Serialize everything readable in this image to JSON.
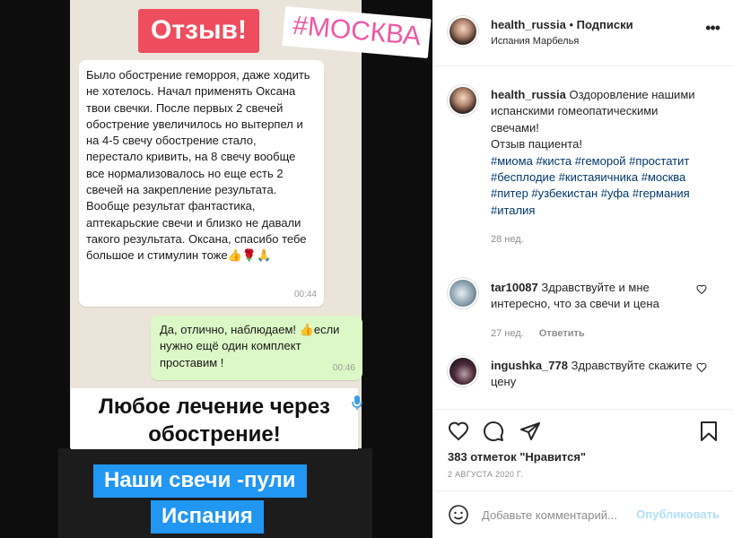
{
  "post": {
    "image": {
      "tag_review": "Отзыв!",
      "tag_city": "#МОСКВА",
      "chat_in": {
        "text": "Было обострение геморроя, даже ходить не хотелось. Начал применять Оксана твои свечки. После первых 2 свечей обострение увеличилось но вытерпел и на 4-5 свечу обострение стало,  перестало кривить, на 8 свечу вообще все нормализовалось но еще есть 2 свечей на закрепление результата. Вообще результат фантастика, аптекарьские свечи и близко не давали такого результата. Оксана, спасибо тебе большое и стимулин тоже👍🌹🙏",
        "time": "00:44"
      },
      "chat_out": {
        "text": "Да, отлично, наблюдаем! 👍если нужно ещё один комплект проставим !",
        "time": "00:46"
      },
      "caption_line1": "Любое лечение через",
      "caption_line2": "обострение!",
      "blue_line1": "Наши свечи -пули",
      "blue_line2": "Испания"
    },
    "header": {
      "username": "health_russia",
      "separator": "•",
      "follow_label": "Подписки",
      "location": "Испания Марбелья",
      "more_icon": "more-horizontal-icon"
    },
    "caption": {
      "username": "health_russia",
      "text": "Оздоровление нашими испанскими гомеопатическими свечами!\nОтзыв пациента!",
      "hashtags": "#миома #киста #геморой #простатит #бесплодие #кистаяичника #москва #питер #узбекистан #уфа #германия #италия",
      "age": "28 нед."
    },
    "comments": [
      {
        "username": "tar10087",
        "text": "Здравствуйте и мне интересно, что за свечи и цена",
        "age": "27 нед.",
        "reply_label": "Ответить"
      },
      {
        "username": "ingushka_778",
        "text": "Здравствуйте скажите цену"
      }
    ],
    "actions": {
      "likes": "383 отметок \"Нравится\"",
      "date": "2 АВГУСТА 2020 Г."
    },
    "add_comment": {
      "placeholder": "Добавьте комментарий...",
      "publish_label": "Опубликовать"
    }
  }
}
